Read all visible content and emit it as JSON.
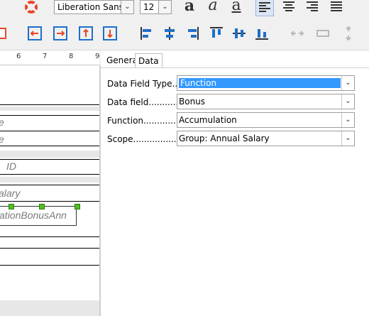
{
  "toolbar": {
    "font_name": "Liberation Sans",
    "font_size": "12",
    "bold_glyph": "a",
    "italic_glyph": "a",
    "underline_glyph": "a"
  },
  "ruler": {
    "ticks": [
      "6",
      "7",
      "8",
      "9"
    ]
  },
  "canvas": {
    "fields": [
      "e",
      "e",
      "ID",
      "alary",
      "ationBonusAnn"
    ]
  },
  "panel": {
    "tabs": [
      {
        "label": "General"
      },
      {
        "label": "Data"
      }
    ],
    "rows": [
      {
        "label": "Data Field Type.....",
        "value": "Function"
      },
      {
        "label": "Data field...............",
        "value": "Bonus"
      },
      {
        "label": "Function................",
        "value": "Accumulation"
      },
      {
        "label": "Scope.......................",
        "value": "Group: Annual Salary"
      }
    ]
  },
  "colors": {
    "selection": "#3399ff",
    "accent": "#1e6fc8",
    "handle": "#4fbf1f"
  }
}
